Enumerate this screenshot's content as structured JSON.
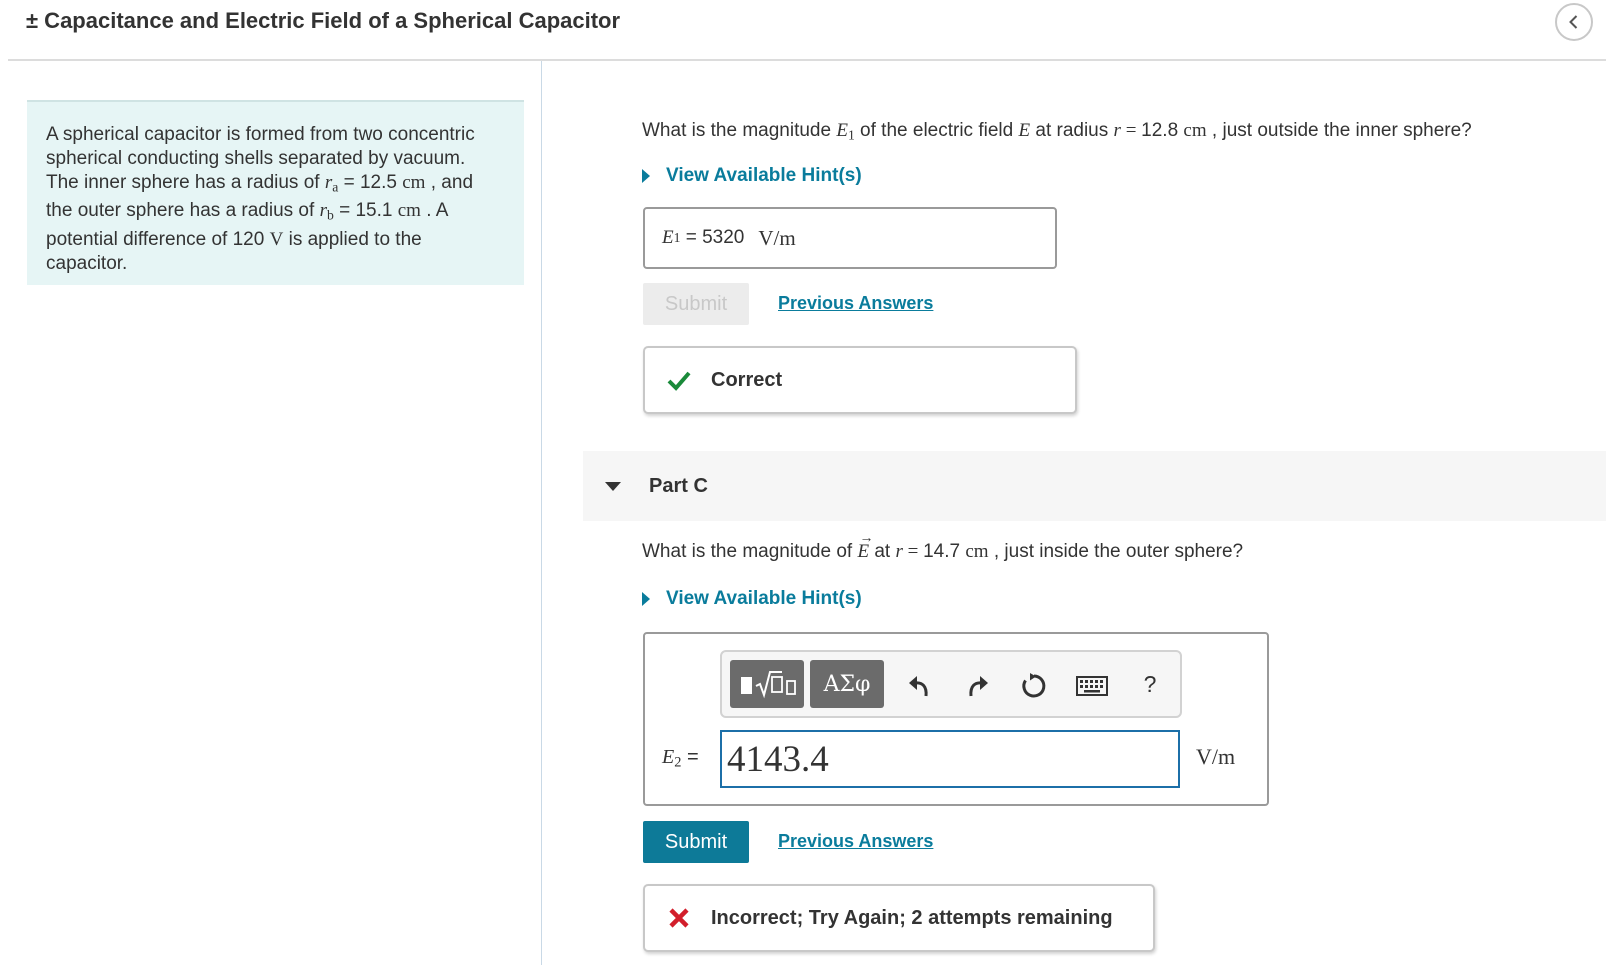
{
  "header": {
    "title": "± Capacitance and Electric Field of a Spherical Capacitor"
  },
  "problem": {
    "line1": "A spherical capacitor is formed from two concentric",
    "line2": "spherical conducting shells separated by vacuum.",
    "line3_a": "The inner sphere has a radius of ",
    "r_a_symbol": "r",
    "r_a_sub": "a",
    "line3_b": " = 12.5 ",
    "unit_cm": "cm",
    "line3_c": " , and",
    "line4_a": "the outer sphere has a radius of ",
    "r_b_symbol": "r",
    "r_b_sub": "b",
    "line4_b": " = 15.1 ",
    "line4_c": " . A",
    "line5_a": "potential difference of 120 ",
    "unit_v": "V",
    "line5_b": " is applied to the",
    "line6": "capacitor."
  },
  "part_b": {
    "question_a": "What is the magnitude ",
    "e_symbol": "E",
    "e_sub": "1",
    "question_b": " of the electric field ",
    "question_c": " at radius ",
    "r_symbol": "r",
    "equals": " = ",
    "question_d": "12.8 ",
    "unit": "cm",
    "question_e": " , just outside the inner sphere?",
    "hint_label": "View Available Hint(s)",
    "answer_label_eq": " = ",
    "answer_value": "5320",
    "answer_unit": "V/m",
    "submit_label": "Submit",
    "previous_answers_label": "Previous Answers",
    "feedback": "Correct"
  },
  "part_c": {
    "title": "Part C",
    "question_a": "What is the magnitude of ",
    "e_vec_symbol": "E",
    "question_b": " at ",
    "r_symbol": "r",
    "equals": " = ",
    "question_c": "14.7 ",
    "unit": "cm",
    "question_d": " , just inside the outer sphere?",
    "hint_label": "View Available Hint(s)",
    "toolbar": {
      "greek_label": "ΑΣφ",
      "help_label": "?"
    },
    "answer_symbol": "E",
    "answer_sub": "2",
    "answer_label_eq": " =",
    "input_value": "4143.4",
    "answer_unit": "V/m",
    "submit_label": "Submit",
    "previous_answers_label": "Previous Answers",
    "feedback": "Incorrect; Try Again; 2 attempts remaining"
  },
  "colors": {
    "accent": "#0a7c9c",
    "submit_active": "#0d7a98",
    "correct": "#1a8a3a",
    "incorrect": "#d21e2b",
    "problem_bg": "#e6f5f5"
  }
}
